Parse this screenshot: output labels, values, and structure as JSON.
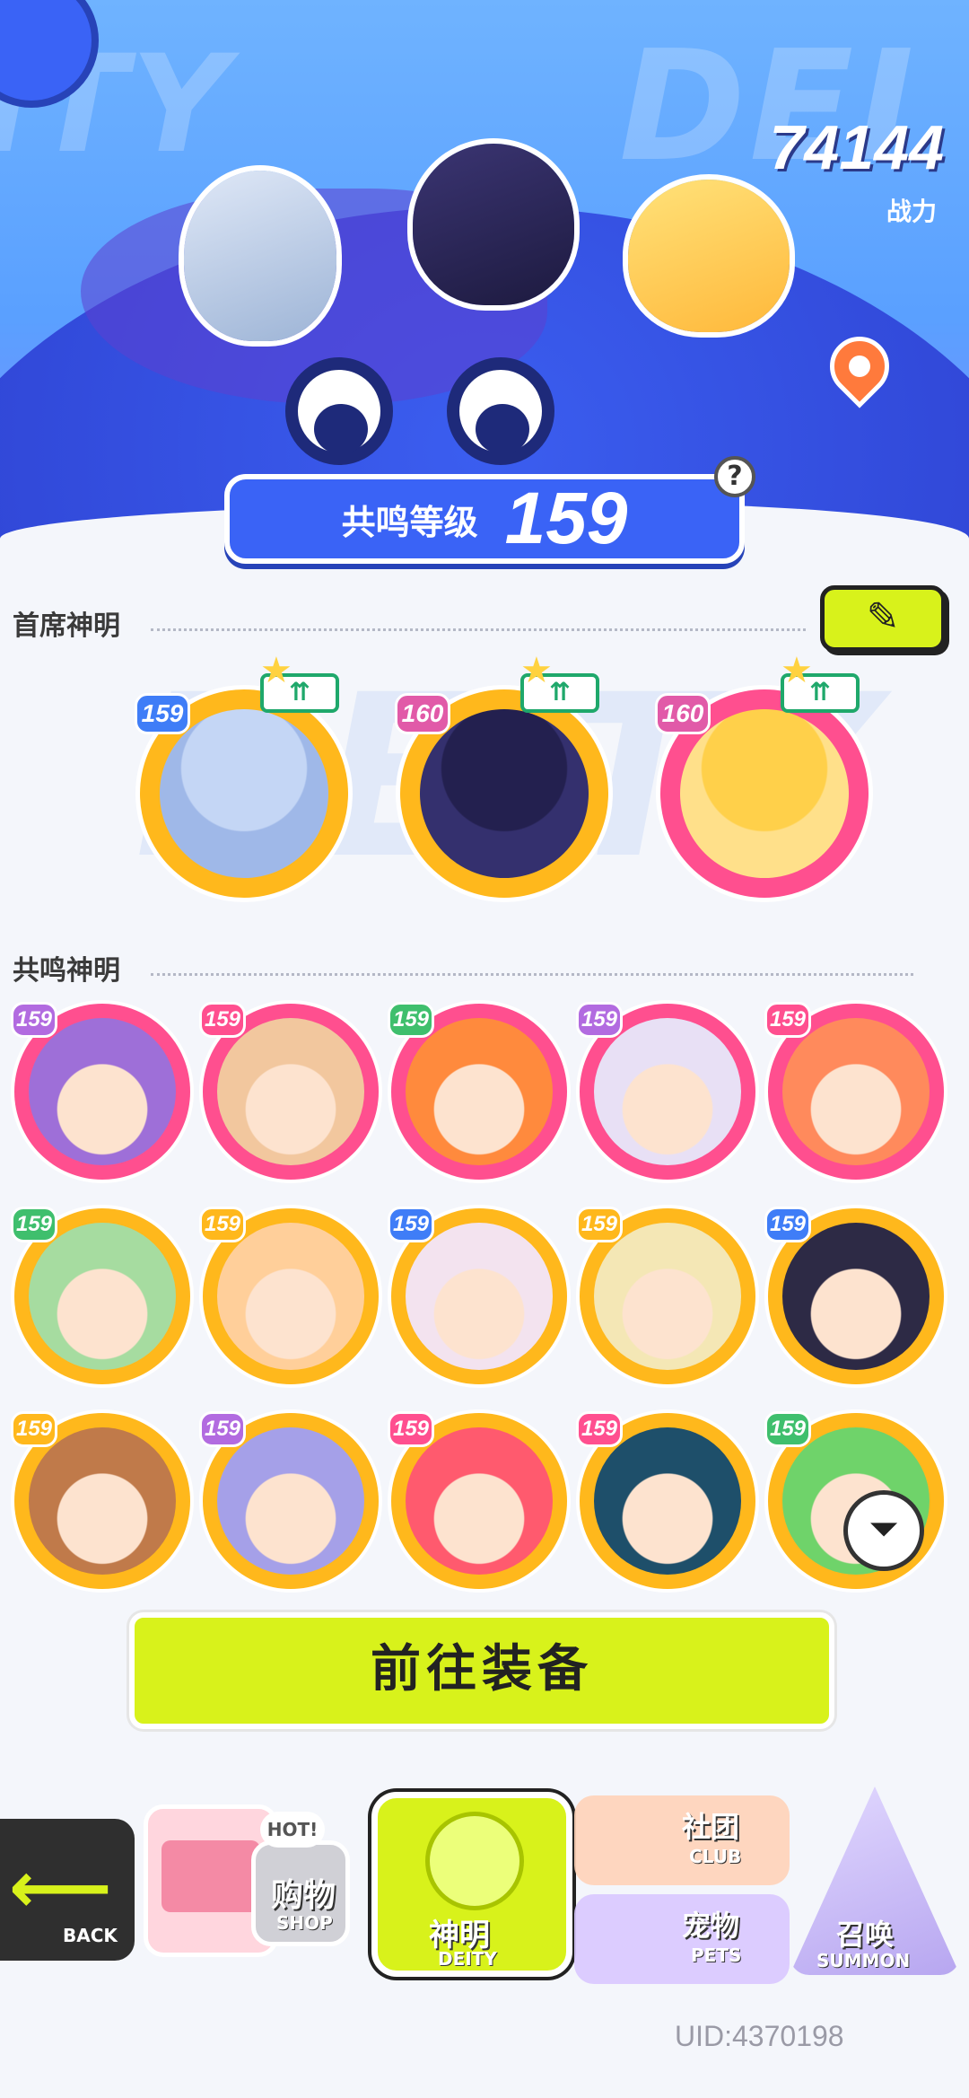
{
  "header": {
    "bg_text_left": "ITY",
    "bg_text_right": "DEI",
    "power_value": "74144",
    "power_label": "战力",
    "location_icon": "map-pin-icon"
  },
  "resonance": {
    "label": "共鸣等级",
    "level": "159",
    "help_label": "?"
  },
  "leaders": {
    "section_title": "首席神明",
    "edit_icon": "pencil-edit-icon",
    "edit_label": "✎",
    "upgrade_label": "⇈",
    "items": [
      {
        "level": "159",
        "ring_color": "#ffb81c",
        "face_color": "#9fb8e8",
        "hair_color": "#c4d6f5",
        "lv_color": "#3f7df7"
      },
      {
        "level": "160",
        "ring_color": "#ffb81c",
        "face_color": "#34306e",
        "hair_color": "#23204f",
        "lv_color": "#e15aa8"
      },
      {
        "level": "160",
        "ring_color": "#ff4f8f",
        "face_color": "#ffe08a",
        "hair_color": "#ffd04a",
        "lv_color": "#e15aa8"
      }
    ]
  },
  "members": {
    "section_title": "共鸣神明",
    "filter_icon": "funnel-filter-icon",
    "filter_label": "⏷",
    "items": [
      {
        "level": "159",
        "ring": "#ff4f8f",
        "face": "#9e6fd8",
        "lv": "#b26be0"
      },
      {
        "level": "159",
        "ring": "#ff4f8f",
        "face": "#f2c79e",
        "lv": "#ff4f8f"
      },
      {
        "level": "159",
        "ring": "#ff4f8f",
        "face": "#ff8a3d",
        "lv": "#3fbf6d"
      },
      {
        "level": "159",
        "ring": "#ff4f8f",
        "face": "#e8e0f5",
        "lv": "#b26be0"
      },
      {
        "level": "159",
        "ring": "#ff4f8f",
        "face": "#ff8a5c",
        "lv": "#ff4f8f"
      },
      {
        "level": "159",
        "ring": "#ffb81c",
        "face": "#a6dca0",
        "lv": "#3fbf6d"
      },
      {
        "level": "159",
        "ring": "#ffb81c",
        "face": "#ffcf9a",
        "lv": "#ffb81c"
      },
      {
        "level": "159",
        "ring": "#ffb81c",
        "face": "#f3e3ef",
        "lv": "#3f7df7"
      },
      {
        "level": "159",
        "ring": "#ffb81c",
        "face": "#f4e7b5",
        "lv": "#ffb81c"
      },
      {
        "level": "159",
        "ring": "#ffb81c",
        "face": "#2d2a45",
        "lv": "#3f7df7"
      },
      {
        "level": "159",
        "ring": "#ffb81c",
        "face": "#c07a4a",
        "lv": "#ffb81c"
      },
      {
        "level": "159",
        "ring": "#ffb81c",
        "face": "#a5a0e8",
        "lv": "#b26be0"
      },
      {
        "level": "159",
        "ring": "#ffb81c",
        "face": "#ff5a6e",
        "lv": "#ff4f8f"
      },
      {
        "level": "159",
        "ring": "#ffb81c",
        "face": "#1e4f6a",
        "lv": "#ff4f8f"
      },
      {
        "level": "159",
        "ring": "#ffb81c",
        "face": "#6fd36a",
        "lv": "#3fbf6d"
      }
    ]
  },
  "equip_button": "前往装备",
  "nav": {
    "back_en": "BACK",
    "back_icon": "arrow-left-icon",
    "shop_cn": "购物",
    "shop_en": "SHOP",
    "shop_badge": "HOT!",
    "deity_cn": "神明",
    "deity_en": "DEITY",
    "club_cn": "社团",
    "club_en": "CLUB",
    "pets_cn": "宠物",
    "pets_en": "PETS",
    "summon_cn": "召唤",
    "summon_en": "SUMMON"
  },
  "uid": "UID:4370198"
}
